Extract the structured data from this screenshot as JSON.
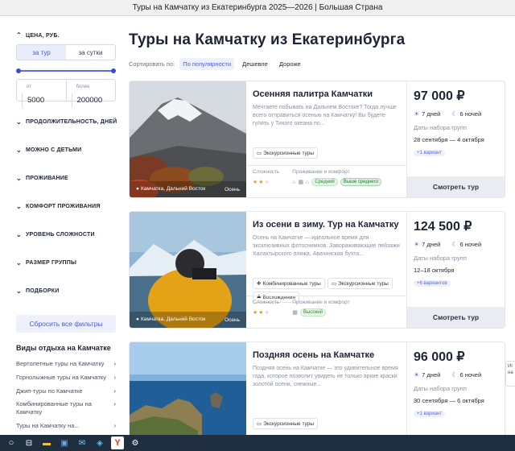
{
  "window": {
    "title": "Туры на Камчатку из Екатеринбурга 2025—2026 | Большая Страна"
  },
  "filters": {
    "price_title": "ЦЕНА, РУБ.",
    "per_tour": "за тур",
    "per_day": "за сутки",
    "from_label": "от",
    "from_value": "5000",
    "to_label": "более",
    "to_value": "200000",
    "sections": [
      "ПРОДОЛЖИТЕЛЬНОСТЬ, ДНЕЙ",
      "МОЖНО С ДЕТЬМИ",
      "ПРОЖИВАНИЕ",
      "КОМФОРТ ПРОЖИВАНИЯ",
      "УРОВЕНЬ СЛОЖНОСТИ",
      "РАЗМЕР ГРУППЫ",
      "ПОДБОРКИ"
    ],
    "reset": "Сбросить все фильтры"
  },
  "types": {
    "title": "Виды отдыха на Камчатке",
    "items": [
      "Вертолетные туры на Камчатку",
      "Горнолыжные туры на Камчатку",
      "Джип-туры по Камчатке",
      "Комбинированные туры на Камчатку",
      "Туры на Камчатку на..."
    ]
  },
  "main": {
    "heading": "Туры на Камчатку из Екатеринбурга",
    "sort_label": "Сортировать по:",
    "sort_options": [
      "По популярности",
      "Дешевле",
      "Дороже"
    ]
  },
  "cards": [
    {
      "title": "Осенняя палитра Камчатки",
      "desc": "Мечтаете побывать на Дальнем Востоке? Тогда лучше всего отправиться осенью на Камчатку! Вы будете гулять у Тихого океана по...",
      "location": "Камчатка, Дальний Восток",
      "season": "Осень",
      "tags": [
        "Экскурсионные туры"
      ],
      "difficulty_label": "Сложность",
      "comfort_label": "Проживание и комфорт",
      "comfort_pills": [
        "Средний",
        "Выше среднего"
      ],
      "difficulty": 2,
      "price": "97 000 ₽",
      "days": "7 дней",
      "nights": "6 ночей",
      "dates_label": "Даты набора групп",
      "dates": "28 сентября — 4 октября",
      "variants": "+1 вариант",
      "button": "Смотреть тур"
    },
    {
      "title": "Из осени в зиму. Тур на Камчатку",
      "desc": "Осень на Камчатке — идеальное время для эксклюзивных фотоснимков. Завораживающие пейзажи Халактырского пляжа, Авачинская бухта...",
      "location": "Камчатка, Дальний Восток",
      "season": "Осень",
      "tags": [
        "Комбинированные туры",
        "Экскурсионные туры",
        "Восхождения"
      ],
      "difficulty_label": "Сложность",
      "comfort_label": "Проживание и комфорт",
      "comfort_pills": [
        "Высокий"
      ],
      "difficulty": 2,
      "price": "124 500 ₽",
      "days": "7 дней",
      "nights": "6 ночей",
      "dates_label": "Даты набора групп",
      "dates": "12–18 октября",
      "variants": "+6 вариантов",
      "button": "Смотреть тур"
    },
    {
      "title": "Поздняя осень на Камчатке",
      "desc": "Поздняя осень на Камчатке — это удивительное время года, которое позволит увидеть не только яркие краски золотой осени, снежные...",
      "tags": [
        "Экскурсионные туры"
      ],
      "price": "96 000 ₽",
      "days": "7 дней",
      "nights": "6 ночей",
      "dates_label": "Даты набора групп",
      "dates": "30 сентября — 6 октября",
      "variants": "+1 вариант"
    }
  ],
  "scroll_hint": "Иг на",
  "colors": {
    "accent": "#4a5bd6",
    "button_bg": "#eaecf1",
    "taskbar": "#1f2f3f"
  }
}
